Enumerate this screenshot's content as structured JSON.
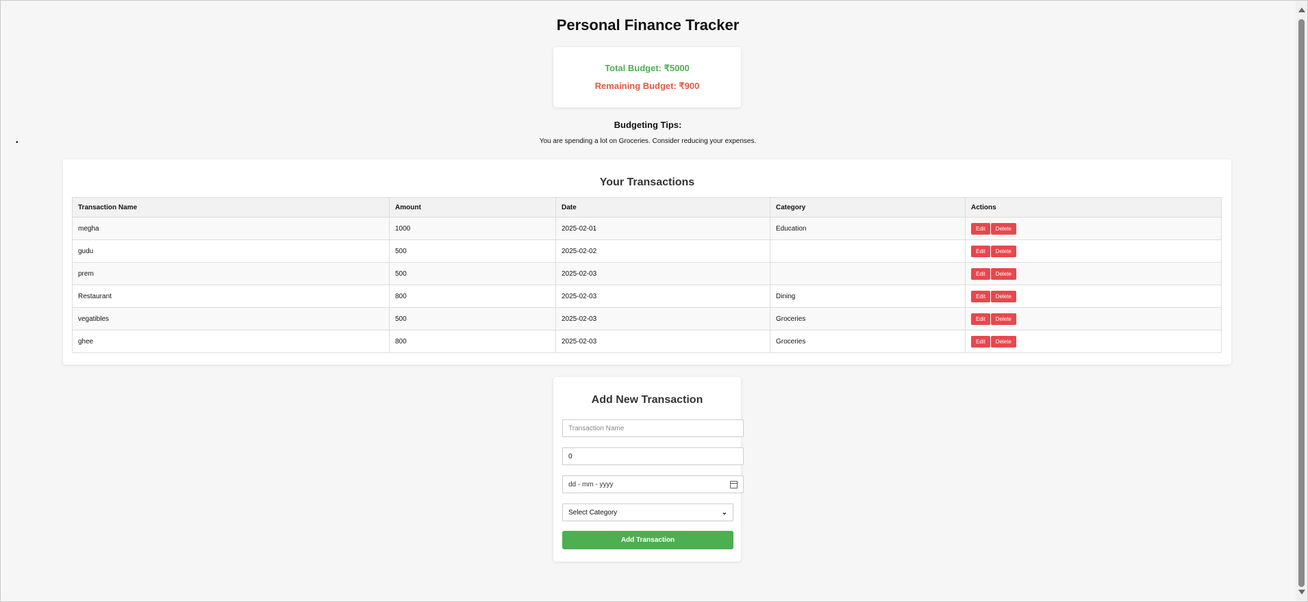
{
  "colors": {
    "budget_total": "#4caf50",
    "budget_remaining": "#e2583e",
    "action_button": "#e8474c",
    "add_button": "#4caf50"
  },
  "page": {
    "title": "Personal Finance Tracker"
  },
  "budget": {
    "total": "Total Budget: ₹5000",
    "remaining": "Remaining Budget: ₹900"
  },
  "tips": {
    "heading": "Budgeting Tips:",
    "bullet": "•",
    "items": [
      "You are spending a lot on Groceries. Consider reducing your expenses."
    ]
  },
  "transactions": {
    "heading": "Your Transactions",
    "columns": [
      "Transaction Name",
      "Amount",
      "Date",
      "Category",
      "Actions"
    ],
    "edit_label": "Edit",
    "delete_label": "Delete",
    "rows": [
      {
        "name": "megha",
        "amount": "1000",
        "date": "2025-02-01",
        "category": "Education"
      },
      {
        "name": "gudu",
        "amount": "500",
        "date": "2025-02-02",
        "category": ""
      },
      {
        "name": "prem",
        "amount": "500",
        "date": "2025-02-03",
        "category": ""
      },
      {
        "name": "Restaurant",
        "amount": "800",
        "date": "2025-02-03",
        "category": "Dining"
      },
      {
        "name": "vegatibles",
        "amount": "500",
        "date": "2025-02-03",
        "category": "Groceries"
      },
      {
        "name": "ghee",
        "amount": "800",
        "date": "2025-02-03",
        "category": "Groceries"
      }
    ]
  },
  "form": {
    "heading": "Add New Transaction",
    "name_placeholder": "Transaction Name",
    "amount_value": "0",
    "date_placeholder": "dd - mm - yyyy",
    "date_icon": "calendar-icon",
    "category_selected": "Select Category",
    "category_icon": "chevron-down-icon",
    "submit_label": "Add Transaction"
  }
}
